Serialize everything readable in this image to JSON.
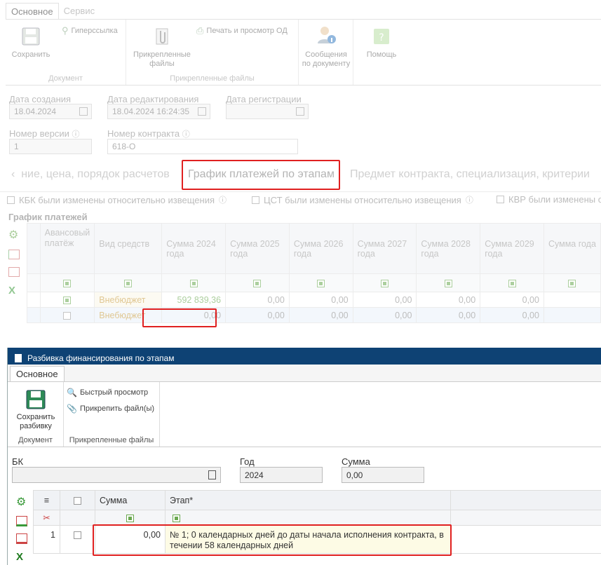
{
  "main": {
    "tabs": [
      "Основное",
      "Сервис"
    ],
    "ribbon": {
      "save_label": "Сохранить",
      "hyperlink_label": "Гиперссылка",
      "doc_group": "Документ",
      "attached_label": "Прикрепленные файлы",
      "print_label": "Печать и просмотр ОД",
      "files_group": "Прикрепленные файлы",
      "messages_label": "Сообщения по документу",
      "help_label": "Помощь"
    },
    "fields": {
      "created_label": "Дата создания",
      "created_value": "18.04.2024",
      "edited_label": "Дата редактирования",
      "edited_value": "18.04.2024 16:24:35",
      "reg_label": "Дата регистрации",
      "reg_value": "",
      "version_label": "Номер версии",
      "version_value": "1",
      "contract_label": "Номер контракта",
      "contract_value": "618-О"
    },
    "section_tabs": {
      "prev": "ние, цена, порядок расчетов",
      "current": "График платежей по этапам",
      "next": "Предмет контракта, специализация, критерии"
    },
    "checks": [
      "КБК были изменены относительно извещения",
      "ЦСТ были изменены относительно извещения",
      "КВР были изменены отн"
    ],
    "grid_title": "График платежей",
    "grid": {
      "headers": [
        "Авансовый платёж",
        "Вид средств",
        "Сумма 2024 года",
        "Сумма 2025 года",
        "Сумма 2026 года",
        "Сумма 2027 года",
        "Сумма 2028 года",
        "Сумма 2029 года",
        "Сумма года"
      ],
      "rows": [
        {
          "source": "Внебюджет",
          "values": [
            "592 839,36",
            "0,00",
            "0,00",
            "0,00",
            "0,00",
            "0,00"
          ]
        },
        {
          "source": "Внебюджет",
          "values": [
            "0,00",
            "0,00",
            "0,00",
            "0,00",
            "0,00",
            "0,00"
          ]
        }
      ]
    }
  },
  "modal": {
    "title": "Разбивка финансирования по этапам",
    "tab": "Основное",
    "ribbon": {
      "save_label": "Сохранить разбивку",
      "doc_group": "Документ",
      "quick_view": "Быстрый просмотр",
      "attach": "Прикрепить файл(ы)",
      "files_group": "Прикрепленные файлы"
    },
    "fields": {
      "bk_label": "БК",
      "bk_value": "",
      "year_label": "Год",
      "year_value": "2024",
      "sum_label": "Сумма",
      "sum_value": "0,00"
    },
    "grid": {
      "col_sum": "Сумма",
      "col_stage": "Этап*",
      "rows": [
        {
          "num": "1",
          "sum": "0,00",
          "stage": "№ 1; 0 календарных дней до даты начала исполнения контракта,  в течении 58 календарных дней"
        }
      ]
    }
  }
}
